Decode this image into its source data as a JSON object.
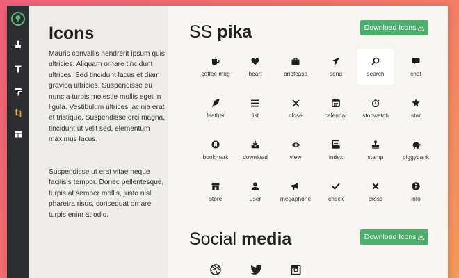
{
  "sidebar": {
    "title": "Icons",
    "paragraph_1": "Mauris convallis hendrerit ipsum quis ultricies. Aliquam ornare tincidunt ultrices. Sed tincidunt lacus et diam gravida ultricies. Suspendisse eu nunc a turpis molestie mollis eget in ligula. Vestibulum ultrices lacinia erat et tristique. Suspendisse orci magna, tincidunt ut velit sed, elementum maximus lacus.",
    "paragraph_2": "Suspendisse ut erat vitae neque facilisis tempor. Donec pellentesque, turpis at semper mollis, justo nisl pharetra risus, consequat ornare turpis enim at odio."
  },
  "rail": {
    "items": [
      {
        "icon": "stamp-icon",
        "active": false
      },
      {
        "icon": "text-icon",
        "active": false
      },
      {
        "icon": "paint-roller-icon",
        "active": false
      },
      {
        "icon": "crop-icon",
        "active": true
      },
      {
        "icon": "layout-icon",
        "active": false
      }
    ],
    "active_color": "#e8b23a"
  },
  "section_pika": {
    "title_light": "SS ",
    "title_bold": "pika",
    "download_label": "Download Icons",
    "icons": [
      {
        "label": "coffee mug",
        "icon": "coffee-mug-icon"
      },
      {
        "label": "heart",
        "icon": "heart-icon"
      },
      {
        "label": "briefcase",
        "icon": "briefcase-icon"
      },
      {
        "label": "send",
        "icon": "send-icon"
      },
      {
        "label": "search",
        "icon": "search-icon",
        "highlighted": true
      },
      {
        "label": "chat",
        "icon": "chat-icon"
      },
      {
        "label": "feather",
        "icon": "feather-icon"
      },
      {
        "label": "list",
        "icon": "list-icon"
      },
      {
        "label": "close",
        "icon": "close-icon"
      },
      {
        "label": "calendar",
        "icon": "calendar-icon"
      },
      {
        "label": "stopwatch",
        "icon": "stopwatch-icon"
      },
      {
        "label": "star",
        "icon": "star-icon"
      },
      {
        "label": "bookmark",
        "icon": "bookmark-icon"
      },
      {
        "label": "download",
        "icon": "download-icon"
      },
      {
        "label": "view",
        "icon": "view-icon"
      },
      {
        "label": "index",
        "icon": "index-icon"
      },
      {
        "label": "stamp",
        "icon": "stamp-icon"
      },
      {
        "label": "piggybank",
        "icon": "piggybank-icon"
      },
      {
        "label": "store",
        "icon": "store-icon"
      },
      {
        "label": "user",
        "icon": "user-icon"
      },
      {
        "label": "megaphone",
        "icon": "megaphone-icon"
      },
      {
        "label": "check",
        "icon": "check-icon"
      },
      {
        "label": "cross",
        "icon": "cross-icon"
      },
      {
        "label": "info",
        "icon": "info-icon"
      }
    ]
  },
  "section_social": {
    "title_light": "Social ",
    "title_bold": "media",
    "download_label": "Download Icons",
    "icons": [
      {
        "icon": "dribbble-icon"
      },
      {
        "icon": "twitter-icon"
      },
      {
        "icon": "instagram-icon"
      }
    ]
  },
  "colors": {
    "accent_green": "#4caf6e",
    "rail_bg": "#2b2d2e",
    "sidebar_bg": "#eeede9",
    "icon_color": "#1f1f1f"
  }
}
